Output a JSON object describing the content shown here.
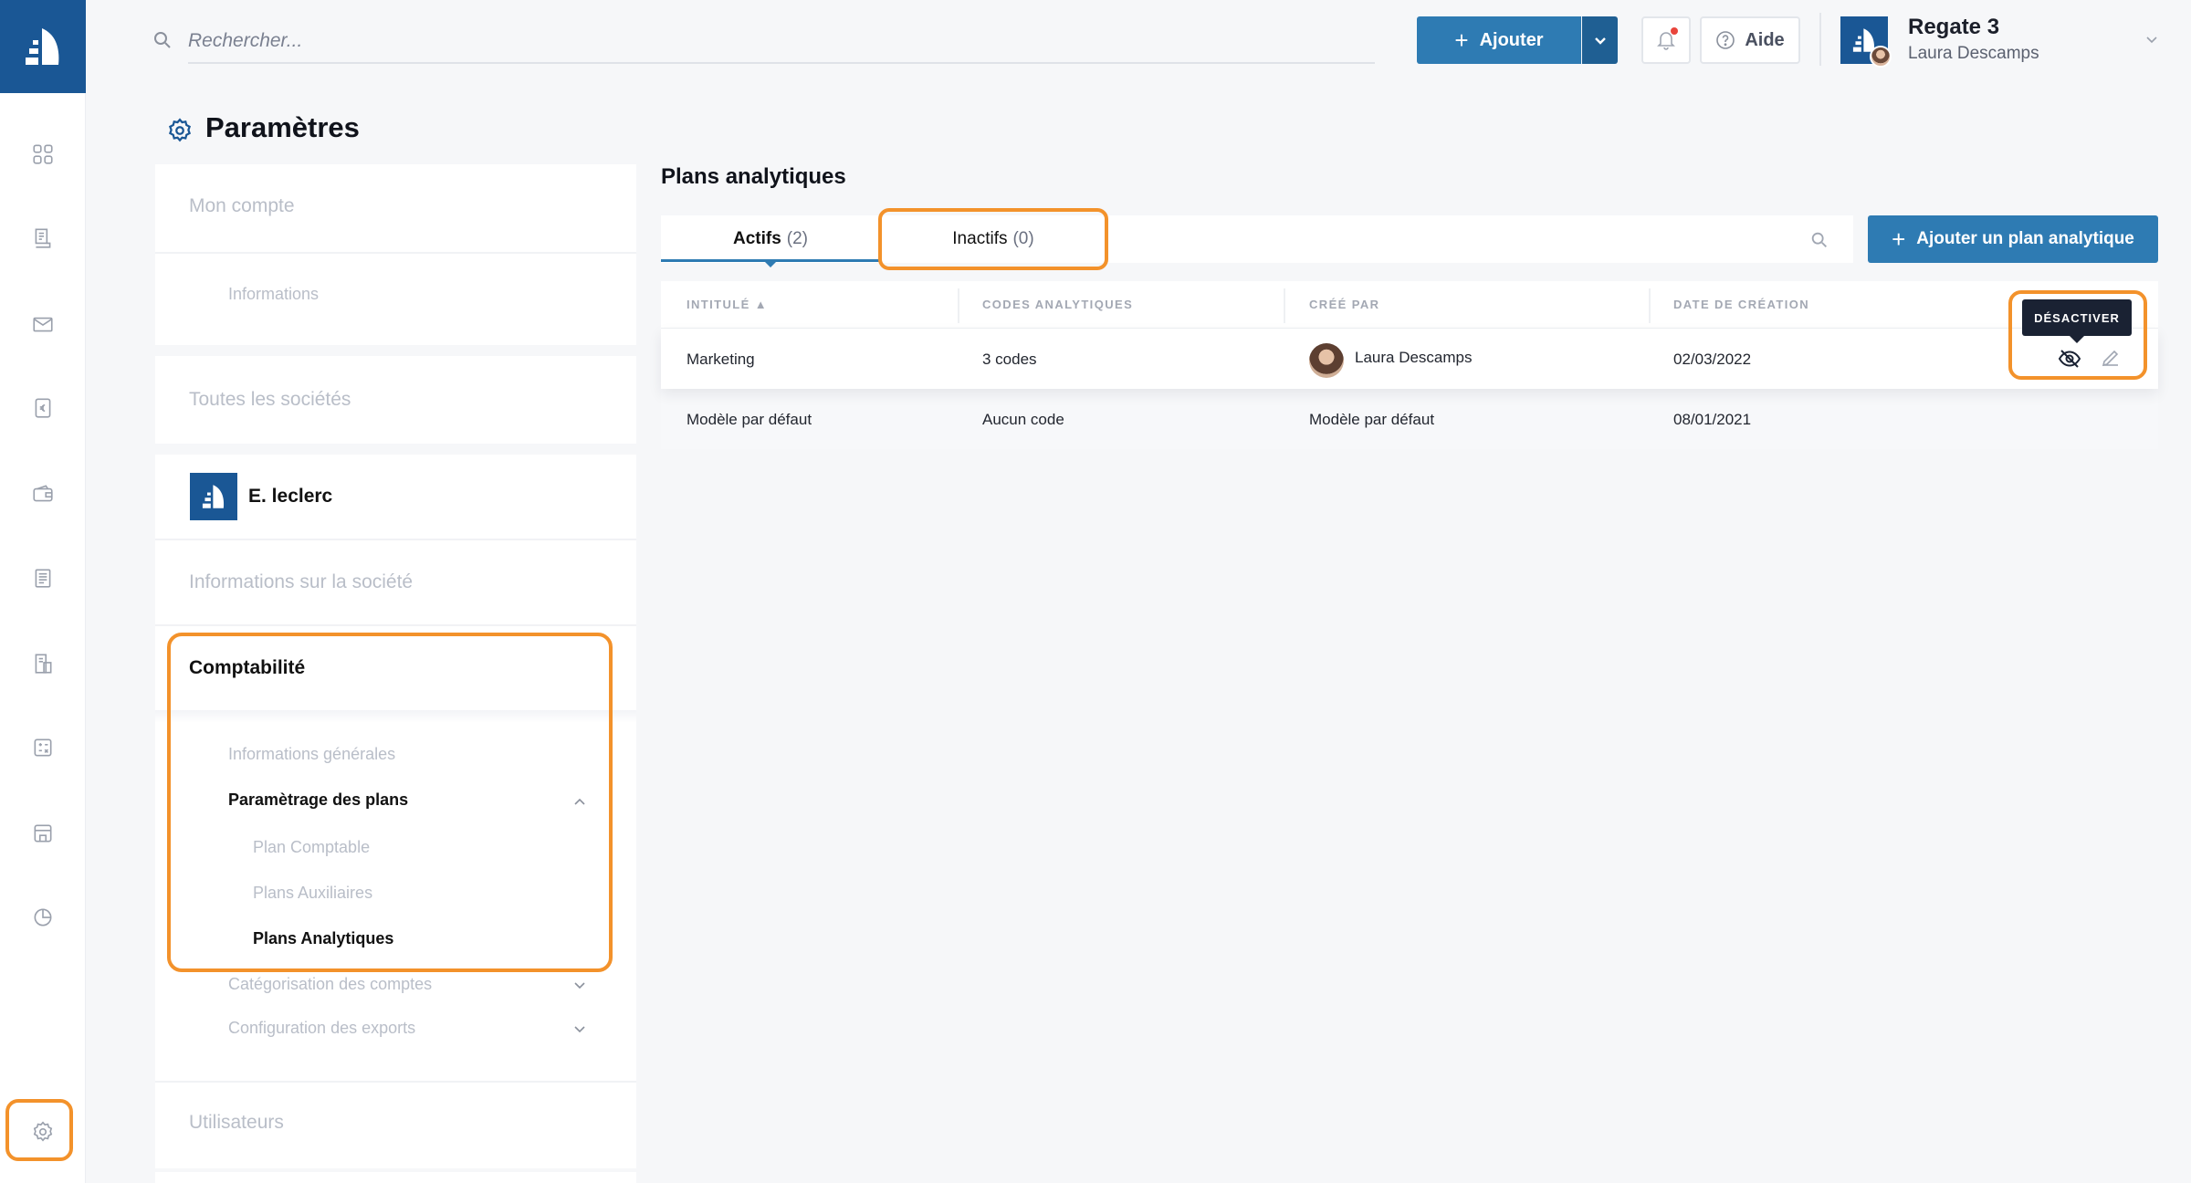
{
  "search": {
    "placeholder": "Rechercher..."
  },
  "header": {
    "add_label": "Ajouter",
    "help_label": "Aide",
    "company_name": "Regate 3",
    "user_name": "Laura Descamps"
  },
  "page": {
    "title": "Paramètres"
  },
  "nav": {
    "mon_compte": "Mon compte",
    "informations": "Informations",
    "toutes_societes": "Toutes les sociétés",
    "societe_name": "E. leclerc",
    "infos_societe": "Informations sur la société",
    "comptabilite": "Comptabilité",
    "infos_generales": "Informations générales",
    "parametrage_plans": "Paramètrage des plans",
    "plan_comptable": "Plan Comptable",
    "plans_auxiliaires": "Plans Auxiliaires",
    "plans_analytiques": "Plans Analytiques",
    "categorisation": "Catégorisation des comptes",
    "configuration_exports": "Configuration des exports",
    "utilisateurs": "Utilisateurs"
  },
  "main": {
    "title": "Plans analytiques",
    "tabs": [
      {
        "label": "Actifs",
        "count": "(2)"
      },
      {
        "label": "Inactifs",
        "count": "(0)"
      }
    ],
    "add_plan_label": "Ajouter un plan analytique",
    "columns": {
      "intitule": "INTITULÉ ▲",
      "codes": "CODES ANALYTIQUES",
      "cree_par": "CRÉÉ PAR",
      "date": "DATE DE CRÉATION"
    },
    "rows": [
      {
        "intitule": "Marketing",
        "codes": "3 codes",
        "cree_par": "Laura Descamps",
        "date": "02/03/2022"
      },
      {
        "intitule": "Modèle par défaut",
        "codes": "Aucun code",
        "cree_par": "Modèle par défaut",
        "date": "08/01/2021"
      }
    ],
    "tooltip": "DÉSACTIVER"
  },
  "colors": {
    "brand": "#1a5795",
    "accent": "#2e7bb3",
    "highlight": "#f3922b"
  }
}
